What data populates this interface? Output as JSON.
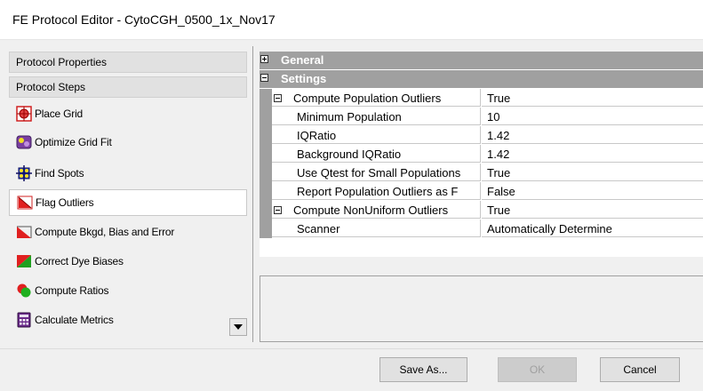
{
  "window": {
    "title": "FE Protocol Editor - CytoCGH_0500_1x_Nov17"
  },
  "left": {
    "protocol_properties": "Protocol Properties",
    "protocol_steps": "Protocol Steps",
    "steps": [
      {
        "label": "Place Grid",
        "icon": "place-grid-icon"
      },
      {
        "label": "Optimize Grid Fit",
        "icon": "optimize-grid-icon"
      },
      {
        "label": "Find Spots",
        "icon": "find-spots-icon"
      },
      {
        "label": "Flag Outliers",
        "icon": "flag-outliers-icon",
        "selected": true
      },
      {
        "label": "Compute Bkgd, Bias and Error",
        "icon": "compute-bkgd-icon"
      },
      {
        "label": "Correct Dye Biases",
        "icon": "correct-dye-icon"
      },
      {
        "label": "Compute Ratios",
        "icon": "compute-ratios-icon"
      },
      {
        "label": "Calculate Metrics",
        "icon": "calculate-metrics-icon"
      }
    ]
  },
  "grid": {
    "general": "General",
    "settings": "Settings",
    "rows": [
      {
        "name": "Compute Population Outliers",
        "value": "True"
      },
      {
        "name": "Minimum Population",
        "value": "10"
      },
      {
        "name": "IQRatio",
        "value": "1.42"
      },
      {
        "name": "Background IQRatio",
        "value": "1.42"
      },
      {
        "name": "Use Qtest for Small Populations",
        "value": "True"
      },
      {
        "name": "Report Population Outliers as F",
        "value": "False"
      },
      {
        "name": "Compute NonUniform Outliers",
        "value": "True"
      },
      {
        "name": "Scanner",
        "value": "Automatically Determine"
      }
    ]
  },
  "footer": {
    "save_as": "Save As...",
    "ok": "OK",
    "cancel": "Cancel"
  },
  "colors": {
    "category_bg": "#a0a0a0",
    "selected_bg": "#ffffff",
    "window_bg": "#f0f0f0"
  }
}
